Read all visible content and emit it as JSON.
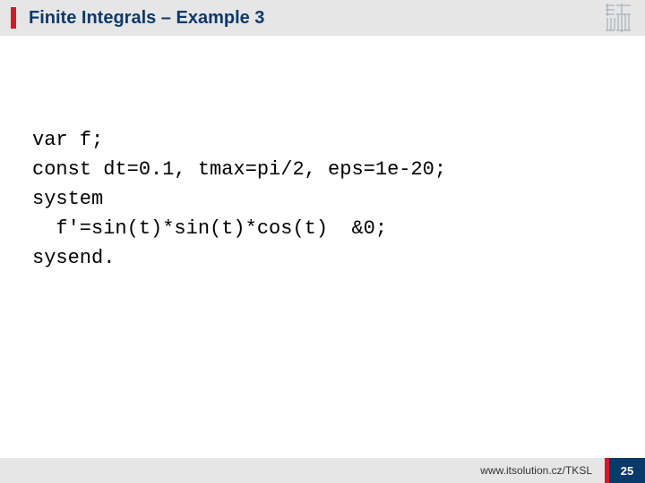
{
  "header": {
    "title": "Finite Integrals – Example 3"
  },
  "code": {
    "line1": "var f;",
    "line2": "const dt=0.1, tmax=pi/2, eps=1e-20;",
    "line3": "system",
    "line4": "  f'=sin(t)*sin(t)*cos(t)  &0;",
    "line5": "sysend."
  },
  "footer": {
    "url": "www.itsolution.cz/TKSL",
    "page": "25"
  }
}
